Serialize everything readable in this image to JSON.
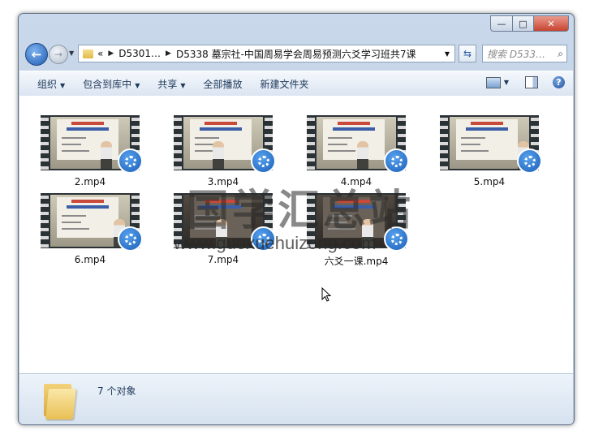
{
  "window": {
    "controls": {
      "minimize": "—",
      "maximize": "□",
      "close": "✕"
    }
  },
  "nav": {
    "back_icon": "arrow-left",
    "forward_icon": "arrow-right",
    "breadcrumb": {
      "overflow": "«",
      "items": [
        "D5301…",
        "D5338 墓宗社-中国周易学会周易预测六爻学习班共7课"
      ]
    },
    "search_placeholder": "搜索 D533…"
  },
  "toolbar": {
    "items": [
      {
        "label": "组织",
        "dropdown": true
      },
      {
        "label": "包含到库中",
        "dropdown": true
      },
      {
        "label": "共享",
        "dropdown": true
      },
      {
        "label": "全部播放",
        "dropdown": false
      },
      {
        "label": "新建文件夹",
        "dropdown": false
      }
    ],
    "help": "?"
  },
  "files": [
    {
      "name": "2.mp4",
      "dark": false
    },
    {
      "name": "3.mp4",
      "dark": false
    },
    {
      "name": "4.mp4",
      "dark": false
    },
    {
      "name": "5.mp4",
      "dark": false
    },
    {
      "name": "6.mp4",
      "dark": false
    },
    {
      "name": "7.mp4",
      "dark": true
    },
    {
      "name": "六爻一课.mp4",
      "dark": true
    }
  ],
  "status": {
    "count": "7 个对象"
  },
  "watermark": {
    "cn": "国学汇总站",
    "url": "www.guoxuehuizong.com"
  },
  "colors": {
    "accent": "#1f5cb3",
    "toolbar_text": "#1e395b",
    "close": "#c7432f"
  }
}
